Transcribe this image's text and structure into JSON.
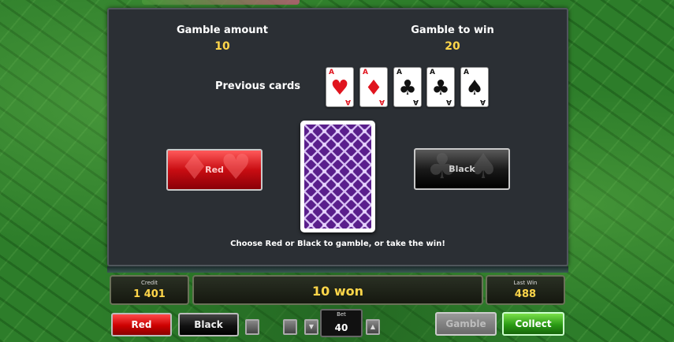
{
  "gamble": {
    "amount_label": "Gamble amount",
    "amount_value": "10",
    "to_win_label": "Gamble to win",
    "to_win_value": "20",
    "previous_cards_label": "Previous cards",
    "previous_cards": [
      {
        "rank": "A",
        "suit": "♥",
        "color": "red"
      },
      {
        "rank": "A",
        "suit": "♦",
        "color": "red"
      },
      {
        "rank": "A",
        "suit": "♣",
        "color": "black"
      },
      {
        "rank": "A",
        "suit": "♣",
        "color": "black"
      },
      {
        "rank": "A",
        "suit": "♠",
        "color": "black"
      }
    ],
    "red_button_label": "Red",
    "black_button_label": "Black",
    "instruction": "Choose Red or Black to gamble, or take the win!"
  },
  "status": {
    "credit_label": "Credit",
    "credit_value": "1 401",
    "message": "10 won",
    "last_win_label": "Last Win",
    "last_win_value": "488"
  },
  "controls": {
    "red_label": "Red",
    "black_label": "Black",
    "bet_label": "Bet",
    "bet_value": "40",
    "gamble_label": "Gamble",
    "collect_label": "Collect",
    "bet_down_icon": "chevron-down-icon",
    "bet_up_icon": "chevron-up-icon"
  },
  "colors": {
    "accent_yellow": "#ffd64a",
    "red": "#e0141e",
    "collect_green": "#2a9a14",
    "panel": "#2b2f34"
  }
}
